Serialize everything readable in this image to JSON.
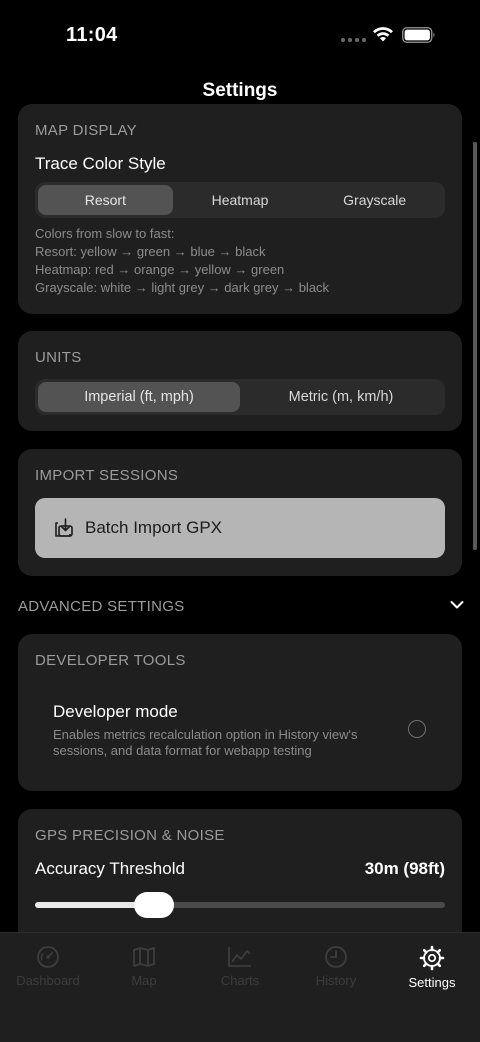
{
  "status": {
    "time": "11:04"
  },
  "nav": {
    "title": "Settings"
  },
  "map_display": {
    "header": "MAP DISPLAY",
    "trace_label": "Trace Color Style",
    "segments": [
      "Resort",
      "Heatmap",
      "Grayscale"
    ],
    "selected": "Resort",
    "help": [
      "Colors from slow to fast:",
      "Resort: yellow → green → blue → black",
      "Heatmap: red → orange → yellow → green",
      "Grayscale: white → light grey → dark grey → black"
    ]
  },
  "units": {
    "header": "UNITS",
    "segments": [
      "Imperial (ft, mph)",
      "Metric (m, km/h)"
    ],
    "selected": "Imperial (ft, mph)"
  },
  "import_sessions": {
    "header": "IMPORT SESSIONS",
    "button_label": "Batch Import GPX",
    "icon": "import-icon"
  },
  "advanced": {
    "label": "ADVANCED SETTINGS",
    "icon": "chevron-down-icon"
  },
  "developer_tools": {
    "header": "DEVELOPER TOOLS",
    "title": "Developer mode",
    "description": "Enables metrics recalculation option in History view's sessions, and data format for webapp testing",
    "enabled": false
  },
  "gps": {
    "header": "GPS PRECISION & NOISE",
    "threshold_label": "Accuracy Threshold",
    "threshold_value": "30m (98ft)",
    "slider_fraction": 0.29
  },
  "tabs": [
    {
      "label": "Dashboard",
      "icon": "gauge-icon",
      "active": false
    },
    {
      "label": "Map",
      "icon": "map-icon",
      "active": false
    },
    {
      "label": "Charts",
      "icon": "chart-icon",
      "active": false
    },
    {
      "label": "History",
      "icon": "clock-icon",
      "active": false
    },
    {
      "label": "Settings",
      "icon": "gear-icon",
      "active": true
    }
  ]
}
